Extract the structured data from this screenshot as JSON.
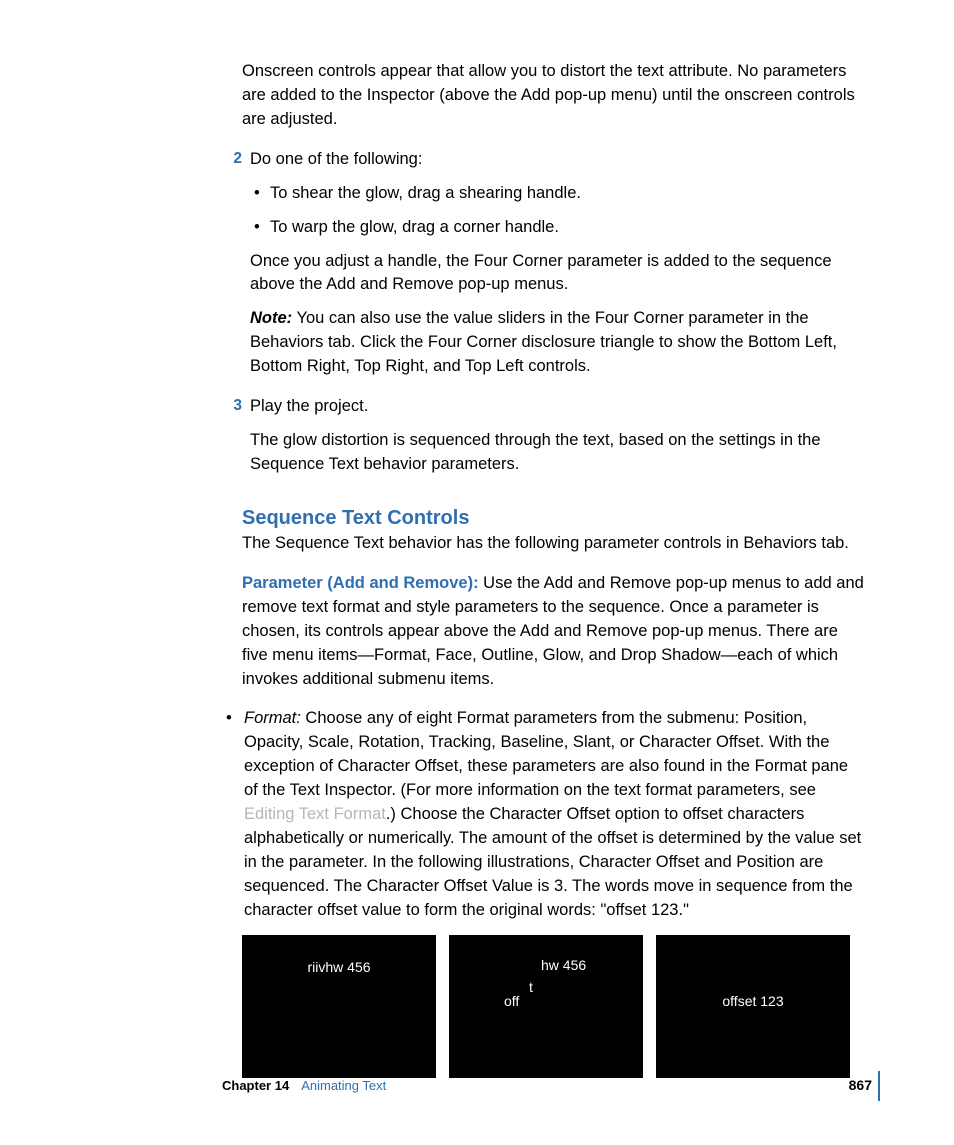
{
  "intro": "Onscreen controls appear that allow you to distort the text attribute. No parameters are added to the Inspector (above the Add pop-up menu) until the onscreen controls are adjusted.",
  "step2": {
    "num": "2",
    "lead": "Do one of the following:",
    "bullets": {
      "b1": "To shear the glow, drag a shearing handle.",
      "b2": "To warp the glow, drag a corner handle."
    },
    "once": "Once you adjust a handle, the Four Corner parameter is added to the sequence above the Add and Remove pop-up menus.",
    "noteLabel": "Note:",
    "noteBody": "  You can also use the value sliders in the Four Corner parameter in the Behaviors tab. Click the Four Corner disclosure triangle to show the Bottom Left, Bottom Right, Top Right, and Top Left controls."
  },
  "step3": {
    "num": "3",
    "lead": "Play the project.",
    "body": "The glow distortion is sequenced through the text, based on the settings in the Sequence Text behavior parameters."
  },
  "section": {
    "heading": "Sequence Text Controls",
    "intro": "The Sequence Text behavior has the following parameter controls in Behaviors tab.",
    "paramLabel": "Parameter (Add and Remove):",
    "paramBody": "  Use the Add and Remove pop-up menus to add and remove text format and style parameters to the sequence. Once a parameter is chosen, its controls appear above the Add and Remove pop-up menus. There are five menu items—Format, Face, Outline, Glow, and Drop Shadow—each of which invokes additional submenu items.",
    "formatLabel": "Format:",
    "formatBodyA": "  Choose any of eight Format parameters from the submenu: Position, Opacity, Scale, Rotation, Tracking, Baseline, Slant, or Character Offset. With the exception of Character Offset, these parameters are also found in the Format pane of the Text Inspector. (For more information on the text format parameters, see ",
    "formatLink": "Editing Text Format",
    "formatBodyB": ".) Choose the Character Offset option to offset characters alphabetically or numerically. The amount of the offset is determined by the value set in the parameter. In the following illustrations, Character Offset and Position are sequenced. The Character Offset Value is 3. The words move in sequence from the character offset value to form the original words: \"offset 123.\""
  },
  "images": {
    "i1": "riivhw 456",
    "i2a": "hw 456",
    "i2b": "t",
    "i2c": "off",
    "i3": "offset 123"
  },
  "footer": {
    "chapter": "Chapter 14",
    "title": "Animating Text",
    "page": "867"
  }
}
